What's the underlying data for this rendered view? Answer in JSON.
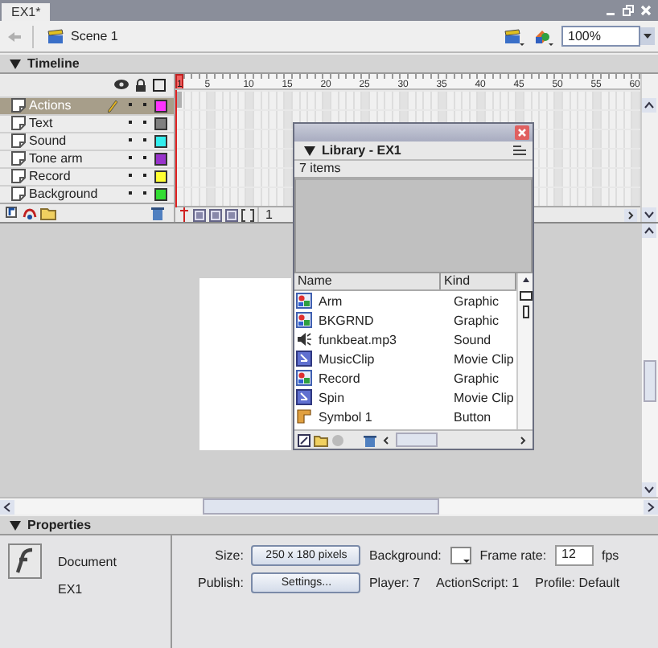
{
  "document_tab": {
    "title": "EX1*",
    "selected": true
  },
  "edit_bar": {
    "scene": "Scene 1",
    "zoom": "100%"
  },
  "timeline": {
    "title": "Timeline",
    "frame_numbers": [
      "1",
      "5",
      "10",
      "15",
      "20",
      "25",
      "30",
      "35",
      "40",
      "45",
      "50",
      "55",
      "60"
    ],
    "current_frame": "1",
    "layers": [
      {
        "name": "Actions",
        "selected": true,
        "editing": true,
        "color": "#ff33ff"
      },
      {
        "name": "Text",
        "selected": false,
        "editing": false,
        "color": "#808080"
      },
      {
        "name": "Sound",
        "selected": false,
        "editing": false,
        "color": "#33eeee"
      },
      {
        "name": "Tone arm",
        "selected": false,
        "editing": false,
        "color": "#9933cc"
      },
      {
        "name": "Record",
        "selected": false,
        "editing": false,
        "color": "#ffff33"
      },
      {
        "name": "Background",
        "selected": false,
        "editing": false,
        "color": "#33dd33"
      }
    ]
  },
  "library": {
    "title": "Library - EX1",
    "item_count": "7 items",
    "columns": [
      "Name",
      "Kind"
    ],
    "items": [
      {
        "name": "Arm",
        "kind_label": "Graphic",
        "kind": "graphic"
      },
      {
        "name": "BKGRND",
        "kind_label": "Graphic",
        "kind": "graphic"
      },
      {
        "name": "funkbeat.mp3",
        "kind_label": "Sound",
        "kind": "sound"
      },
      {
        "name": "MusicClip",
        "kind_label": "Movie Clip",
        "kind": "movieclip"
      },
      {
        "name": "Record",
        "kind_label": "Graphic",
        "kind": "graphic"
      },
      {
        "name": "Spin",
        "kind_label": "Movie Clip",
        "kind": "movieclip"
      },
      {
        "name": "Symbol 1",
        "kind_label": "Button",
        "kind": "button"
      }
    ]
  },
  "properties": {
    "title": "Properties",
    "doc_type": "Document",
    "doc_name": "EX1",
    "size_label": "Size:",
    "size_button": "250 x 180 pixels",
    "publish_label": "Publish:",
    "settings_button": "Settings...",
    "background_label": "Background:",
    "frame_rate_label": "Frame rate:",
    "frame_rate": "12",
    "fps": "fps",
    "player": "Player: 7",
    "actionscript": "ActionScript: 1",
    "profile": "Profile: Default"
  }
}
